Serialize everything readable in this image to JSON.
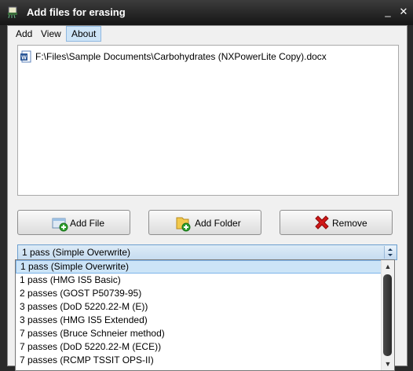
{
  "window": {
    "title": "Add files for erasing",
    "minimize_glyph": "_",
    "close_glyph": "✕"
  },
  "menu": {
    "items": [
      {
        "label": "Add"
      },
      {
        "label": "View"
      },
      {
        "label": "About"
      }
    ]
  },
  "files": [
    {
      "path": "F:\\Files\\Sample Documents\\Carbohydrates (NXPowerLite Copy).docx",
      "icon": "word-document-icon"
    }
  ],
  "buttons": {
    "add_file": "Add File",
    "add_folder": "Add Folder",
    "remove": "Remove"
  },
  "method": {
    "selected": "1 pass (Simple Overwrite)",
    "options": [
      "1 pass (Simple Overwrite)",
      "1 pass (HMG IS5 Basic)",
      "2 passes (GOST P50739-95)",
      "3 passes (DoD 5220.22-M (E))",
      "3 passes (HMG IS5 Extended)",
      "7 passes (Bruce Schneier method)",
      "7 passes (DoD 5220.22-M (ECE))",
      "7 passes (RCMP TSSIT OPS-II)"
    ]
  },
  "colors": {
    "accent": "#cce4f7",
    "remove_red": "#d01818",
    "add_green": "#2ea12e"
  }
}
